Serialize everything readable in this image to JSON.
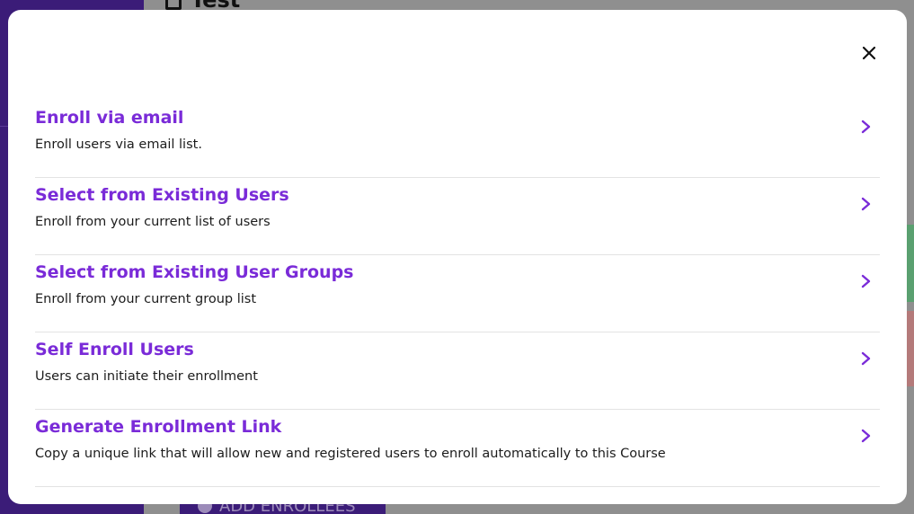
{
  "background": {
    "page_title": "Test",
    "add_button_label": "ADD ENROLLEES"
  },
  "modal": {
    "close_icon": "close-icon",
    "options": [
      {
        "title": "Enroll via email",
        "description": "Enroll users via email list.",
        "icon": "chevron-right-icon"
      },
      {
        "title": "Select from Existing Users",
        "description": "Enroll from your current list of users",
        "icon": "chevron-right-icon"
      },
      {
        "title": "Select from Existing User Groups",
        "description": "Enroll from your current group list",
        "icon": "chevron-right-icon"
      },
      {
        "title": "Self Enroll Users",
        "description": "Users can initiate their enrollment",
        "icon": "chevron-right-icon"
      },
      {
        "title": "Generate Enrollment Link",
        "description": "Copy a unique link that will allow new and registered users to enroll automatically to this Course",
        "icon": "chevron-right-icon"
      }
    ]
  },
  "colors": {
    "accent": "#7a2bd8",
    "overlay": "#8f8f8f",
    "sidebar": "#3b1c78"
  }
}
